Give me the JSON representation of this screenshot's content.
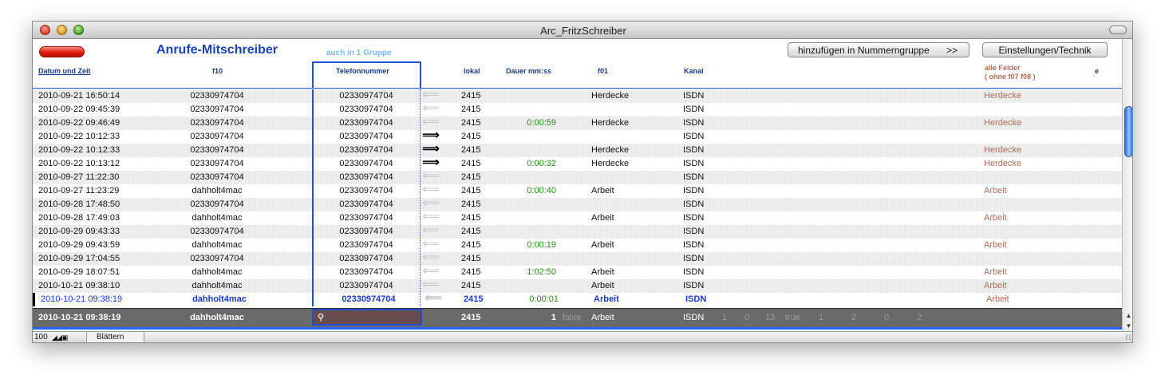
{
  "window": {
    "title": "Arc_FritzSchreiber"
  },
  "header": {
    "app_title": "Anrufe-Mitschreiber",
    "group_note": "auch in 1 Gruppe",
    "add_button": "hinzufügen in Nummerngruppe",
    "add_button_arrow": ">>",
    "settings_button": "Einstellungen/Technik"
  },
  "columns": {
    "datum": "Datum und Zeit",
    "f10": "f10",
    "telefon": "Telefonnummer",
    "lokal": "lokal",
    "dauer": "Dauer mm:ss",
    "f01": "f01",
    "kanal": "Kanal",
    "alle_line1": "alle Felder",
    "alle_line2": "( ohne f07 f08 )",
    "e": "e"
  },
  "rows": [
    {
      "datetime": "2010-09-21  16:50:14",
      "f10": "02330974704",
      "tel": "02330974704",
      "dir": "in",
      "lokal": "2415",
      "dauer": "",
      "f01": "Herdecke",
      "kanal": "ISDN",
      "alle": "Herdecke"
    },
    {
      "datetime": "2010-09-22  09:45:39",
      "f10": "02330974704",
      "tel": "02330974704",
      "dir": "in",
      "lokal": "2415",
      "dauer": "",
      "f01": "",
      "kanal": "ISDN",
      "alle": ""
    },
    {
      "datetime": "2010-09-22  09:46:49",
      "f10": "02330974704",
      "tel": "02330974704",
      "dir": "in",
      "lokal": "2415",
      "dauer": "0:00:59",
      "f01": "Herdecke",
      "kanal": "ISDN",
      "alle": "Herdecke"
    },
    {
      "datetime": "2010-09-22  10:12:33",
      "f10": "02330974704",
      "tel": "02330974704",
      "dir": "out",
      "lokal": "2415",
      "dauer": "",
      "f01": "",
      "kanal": "ISDN",
      "alle": ""
    },
    {
      "datetime": "2010-09-22  10:12:33",
      "f10": "02330974704",
      "tel": "02330974704",
      "dir": "out",
      "lokal": "2415",
      "dauer": "",
      "f01": "Herdecke",
      "kanal": "ISDN",
      "alle": "Herdecke"
    },
    {
      "datetime": "2010-09-22  10:13:12",
      "f10": "02330974704",
      "tel": "02330974704",
      "dir": "out",
      "lokal": "2415",
      "dauer": "0:00:32",
      "f01": "Herdecke",
      "kanal": "ISDN",
      "alle": "Herdecke"
    },
    {
      "datetime": "2010-09-27  11:22:30",
      "f10": "02330974704",
      "tel": "02330974704",
      "dir": "in",
      "lokal": "2415",
      "dauer": "",
      "f01": "",
      "kanal": "ISDN",
      "alle": ""
    },
    {
      "datetime": "2010-09-27  11:23:29",
      "f10": "dahholt4mac",
      "tel": "02330974704",
      "dir": "in",
      "lokal": "2415",
      "dauer": "0:00:40",
      "f01": "Arbeit",
      "kanal": "ISDN",
      "alle": "Arbeit"
    },
    {
      "datetime": "2010-09-28  17:48:50",
      "f10": "02330974704",
      "tel": "02330974704",
      "dir": "in",
      "lokal": "2415",
      "dauer": "",
      "f01": "",
      "kanal": "ISDN",
      "alle": ""
    },
    {
      "datetime": "2010-09-28  17:49:03",
      "f10": "dahholt4mac",
      "tel": "02330974704",
      "dir": "in",
      "lokal": "2415",
      "dauer": "",
      "f01": "Arbeit",
      "kanal": "ISDN",
      "alle": "Arbeit"
    },
    {
      "datetime": "2010-09-29  09:43:33",
      "f10": "02330974704",
      "tel": "02330974704",
      "dir": "in",
      "lokal": "2415",
      "dauer": "",
      "f01": "",
      "kanal": "ISDN",
      "alle": ""
    },
    {
      "datetime": "2010-09-29  09:43:59",
      "f10": "dahholt4mac",
      "tel": "02330974704",
      "dir": "in",
      "lokal": "2415",
      "dauer": "0:00:19",
      "f01": "Arbeit",
      "kanal": "ISDN",
      "alle": "Arbeit"
    },
    {
      "datetime": "2010-09-29  17:04:55",
      "f10": "02330974704",
      "tel": "02330974704",
      "dir": "in",
      "lokal": "2415",
      "dauer": "",
      "f01": "",
      "kanal": "ISDN",
      "alle": ""
    },
    {
      "datetime": "2010-09-29  18:07:51",
      "f10": "dahholt4mac",
      "tel": "02330974704",
      "dir": "in",
      "lokal": "2415",
      "dauer": "1:02:50",
      "f01": "Arbeit",
      "kanal": "ISDN",
      "alle": "Arbeit"
    },
    {
      "datetime": "2010-10-21  09:38:10",
      "f10": "dahholt4mac",
      "tel": "02330974704",
      "dir": "in",
      "lokal": "2415",
      "dauer": "",
      "f01": "Arbeit",
      "kanal": "ISDN",
      "alle": "Arbeit"
    },
    {
      "datetime": "2010-10-21  09:38:19",
      "f10": "dahholt4mac",
      "tel": "02330974704",
      "dir": "in",
      "lokal": "2415",
      "dauer": "0:00:01",
      "f01": "Arbeit",
      "kanal": "ISDN",
      "alle": "Arbeit",
      "selected": true
    }
  ],
  "entry": {
    "datetime": "2010-10-21  09:38:19",
    "f10": "dahholt4mac",
    "lokal": "2415",
    "dauer": "1",
    "flag": "false",
    "f01": "Arbeit",
    "kanal": "ISDN",
    "extras": [
      "1",
      "0",
      "13",
      "true",
      "1",
      "2",
      "0",
      "2"
    ]
  },
  "statusbar": {
    "zoom": "100",
    "mode": "Blättern"
  },
  "icons": {
    "direction_in": "left-arrow-icon",
    "direction_out": "right-double-arrow-icon",
    "search": "magnifier-icon"
  },
  "colors": {
    "accent": "#1f4fd6",
    "title_blue": "#1a44b5",
    "duration_green": "#2a8a1a",
    "alle_brown": "#b86a58"
  }
}
